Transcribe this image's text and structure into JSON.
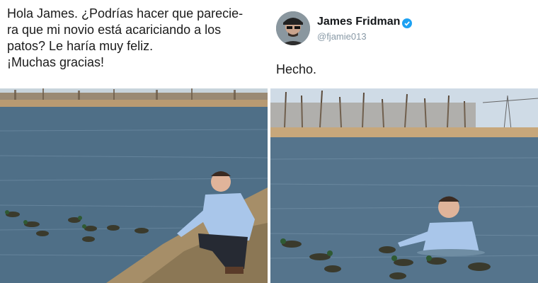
{
  "request": {
    "lines": [
      "Hola James. ¿Podrías hacer que parecie-",
      "ra que mi novio está acariciando a los",
      "patos? Le haría muy feliz.",
      "¡Muchas gracias!"
    ]
  },
  "reply": {
    "author_name": "James Fridman",
    "author_handle": "@fjamie013",
    "verified_icon": "verified-badge-icon",
    "text": "Hecho."
  },
  "colors": {
    "text": "#1b1b1b",
    "handle": "#8899a6",
    "verified": "#1da1f2",
    "water": "#4f6f87",
    "shore": "#b89a72",
    "sky": "#cfdbe6",
    "shirt": "#a9c6ea"
  }
}
